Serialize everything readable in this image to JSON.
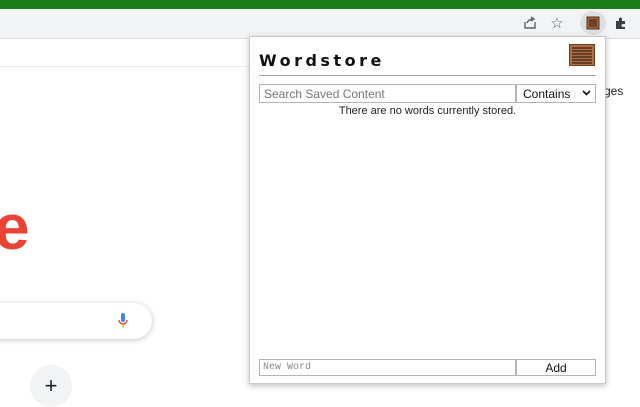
{
  "browser": {
    "toolbar_icons": [
      "share-icon",
      "star-icon",
      "wordstore-extension-icon",
      "puzzle-extensions-icon"
    ],
    "colors": {
      "top_bar": "#1a7f1a",
      "toolbar": "#f1f3f4"
    }
  },
  "background_page": {
    "logo_fragment": "e",
    "partial_text": "ges",
    "plus_label": "+"
  },
  "popup": {
    "title": "Wordstore",
    "search": {
      "placeholder": "Search Saved Content",
      "value": ""
    },
    "match_mode": {
      "selected": "Contains"
    },
    "empty_message": "There are no words currently stored.",
    "new_word": {
      "placeholder": "New Word",
      "value": ""
    },
    "add_label": "Add",
    "colors": {
      "logo": "#a0633c",
      "accent": "#111111"
    }
  }
}
